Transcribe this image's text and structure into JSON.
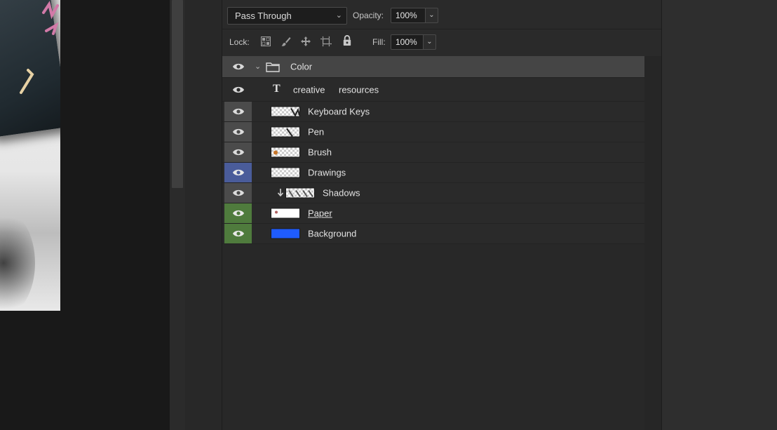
{
  "document": {
    "alt": "keyboard keys artwork"
  },
  "layers_panel": {
    "blend_mode": "Pass Through",
    "opacity_label": "Opacity:",
    "opacity_value": "100%",
    "lock_label": "Lock:",
    "fill_label": "Fill:",
    "fill_value": "100%",
    "lock_icons": [
      "lock-transparent-pixels-icon",
      "lock-image-pixels-icon",
      "lock-position-icon",
      "lock-artboard-icon",
      "lock-all-icon"
    ],
    "layers": [
      {
        "name": "Color",
        "kind": "group",
        "eye_color": "none",
        "expanded": true
      },
      {
        "name_parts": [
          "creative",
          "resources"
        ],
        "kind": "text",
        "eye_color": "none"
      },
      {
        "name": "Keyboard Keys",
        "kind": "pixel",
        "eye_color": "gray",
        "thumb": "checker"
      },
      {
        "name": "Pen",
        "kind": "pixel",
        "eye_color": "gray",
        "thumb": "checker"
      },
      {
        "name": "Brush",
        "kind": "pixel",
        "eye_color": "gray",
        "thumb": "checker"
      },
      {
        "name": "Drawings",
        "kind": "pixel",
        "eye_color": "blue",
        "thumb": "checker"
      },
      {
        "name": "Shadows",
        "kind": "pixel",
        "eye_color": "gray",
        "thumb": "checker",
        "clipped": true
      },
      {
        "name": "Paper",
        "kind": "pixel",
        "eye_color": "green",
        "thumb": "white"
      },
      {
        "name": "Background",
        "kind": "pixel",
        "eye_color": "green",
        "thumb": "blue"
      }
    ]
  },
  "colors": {
    "eye_gray": "#4b4b4b",
    "eye_blue": "#4a5c9a",
    "eye_green": "#4f7b3d",
    "background_thumb": "#1f5cff"
  }
}
